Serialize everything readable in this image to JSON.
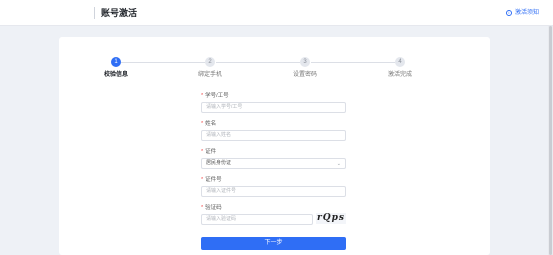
{
  "header": {
    "title": "账号激活",
    "notice_label": "激活须知",
    "notice_icon": "info-circle-icon"
  },
  "steps": [
    {
      "number": "1",
      "label": "校验信息",
      "active": true
    },
    {
      "number": "2",
      "label": "绑定手机",
      "active": false
    },
    {
      "number": "3",
      "label": "设置密码",
      "active": false
    },
    {
      "number": "4",
      "label": "激活完成",
      "active": false
    }
  ],
  "form": {
    "required_mark": "*",
    "student_id": {
      "label": "学号/工号",
      "placeholder": "请输入学号/工号"
    },
    "name": {
      "label": "姓名",
      "placeholder": "请输入姓名"
    },
    "id_type": {
      "label": "证件",
      "value": "居民身份证"
    },
    "id_number": {
      "label": "证件号",
      "placeholder": "请输入证件号"
    },
    "captcha": {
      "label": "验证码",
      "placeholder": "请输入验证码",
      "image_text": "rQps"
    },
    "next_label": "下一步"
  },
  "colors": {
    "accent": "#2f6ef5",
    "required": "#f04b4b"
  }
}
